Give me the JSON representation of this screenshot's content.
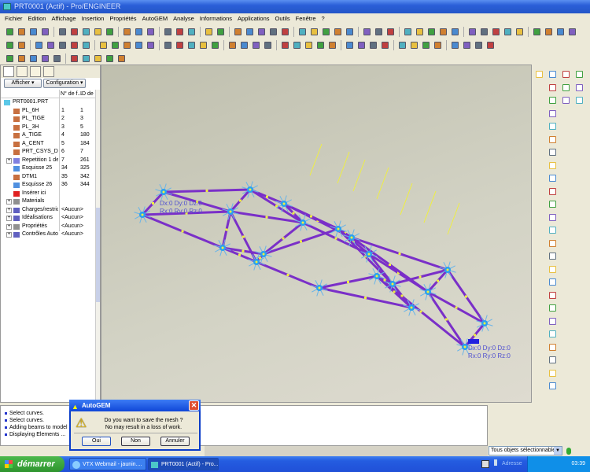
{
  "window": {
    "title": "PRT0001 (Actif) - Pro/ENGINEER"
  },
  "menu": [
    "Fichier",
    "Edition",
    "Affichage",
    "Insertion",
    "Propriétés",
    "AutoGEM",
    "Analyse",
    "Informations",
    "Applications",
    "Outils",
    "Fenêtre",
    "?"
  ],
  "left_panel": {
    "buttons": {
      "show": "Afficher ▾",
      "config": "Configuration ▾"
    },
    "columns": {
      "name": "",
      "num": "N° de f...",
      "id": "ID de"
    },
    "tree": [
      {
        "name": "PRT0001.PRT",
        "num": "",
        "id": "",
        "icon": "part-icon"
      },
      {
        "name": "PL_6H",
        "num": "1",
        "id": "1",
        "icon": "datum-plane-icon"
      },
      {
        "name": "PL_TIGE",
        "num": "2",
        "id": "3",
        "icon": "datum-plane-icon"
      },
      {
        "name": "PL_3H",
        "num": "3",
        "id": "5",
        "icon": "datum-plane-icon"
      },
      {
        "name": "A_TIGE",
        "num": "4",
        "id": "180",
        "icon": "datum-axis-icon"
      },
      {
        "name": "A_CENT",
        "num": "5",
        "id": "184",
        "icon": "datum-axis-icon"
      },
      {
        "name": "PRT_CSYS_DEF",
        "num": "6",
        "id": "7",
        "icon": "csys-icon"
      },
      {
        "name": "Repetition 1 de",
        "num": "7",
        "id": "261",
        "icon": "pattern-icon",
        "expandable": true
      },
      {
        "name": "Esquisse 25",
        "num": "34",
        "id": "325",
        "icon": "sketch-icon"
      },
      {
        "name": "DTM1",
        "num": "35",
        "id": "342",
        "icon": "datum-plane-icon"
      },
      {
        "name": "Esquisse 26",
        "num": "36",
        "id": "344",
        "icon": "sketch-icon"
      },
      {
        "name": "Insérer ici",
        "num": "",
        "id": "",
        "icon": "insert-here-icon"
      },
      {
        "name": "Materials",
        "num": "",
        "id": "",
        "icon": "folder-icon",
        "expandable": true
      },
      {
        "name": "Charges/restrictions",
        "num": "<Aucun>",
        "id": "",
        "icon": "loads-icon",
        "expandable": true
      },
      {
        "name": "Idéalisations",
        "num": "<Aucun>",
        "id": "",
        "icon": "idealization-icon",
        "expandable": true
      },
      {
        "name": "Propriétés",
        "num": "<Aucun>",
        "id": "",
        "icon": "folder-icon",
        "expandable": true
      },
      {
        "name": "Contrôles AutoGEM",
        "num": "<Aucun>",
        "id": "",
        "icon": "autogem-controls-icon",
        "expandable": true
      }
    ]
  },
  "viewport": {
    "labels": [
      {
        "text": "Dx:0 Dy:0 Dz:0",
        "color": "#5050d0"
      },
      {
        "text": "Rx:0 Ry:0 Rz:0",
        "color": "#5050d0"
      },
      {
        "text": "Dx:0 Dy:0 Dz:0",
        "color": "#5050d0"
      },
      {
        "text": "Rx:0 Ry:0 Rz:0",
        "color": "#5050d0"
      }
    ],
    "colors": {
      "beam": "#7a2fc8",
      "node": "#2aa0f0",
      "load": "#f0f040",
      "background": "#c8c8b8"
    }
  },
  "messages": [
    "Select curves.",
    "Select curves.",
    "Adding beams to model ...",
    "Displaying Elements ..."
  ],
  "dialog": {
    "title": "AutoGEM",
    "line1": "Do you want to save the mesh ?",
    "line2": "No may result in a loss of work.",
    "buttons": {
      "yes": "Oui",
      "no": "Non",
      "cancel": "Annuler"
    },
    "icon": "warning-icon"
  },
  "status": {
    "filter": "Tous objets sélectionnables"
  },
  "taskbar": {
    "start": "démarrer",
    "tasks": [
      "VTX Webmail - jaunin....",
      "PRT0001 (Actif) - Pro..."
    ],
    "address": "Adresse",
    "clock": "03:39"
  }
}
